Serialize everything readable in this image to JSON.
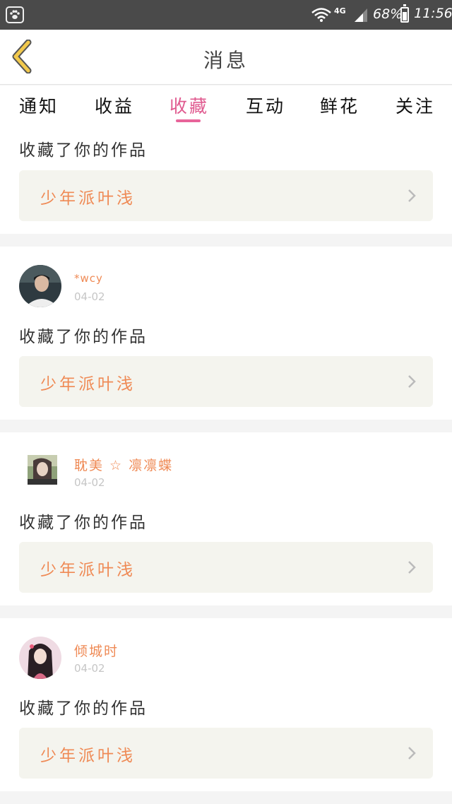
{
  "status_bar": {
    "network": "4G",
    "battery_percent": "68%",
    "battery_level": 0.68,
    "time": "11:56"
  },
  "header": {
    "title": "消息"
  },
  "tabs": [
    {
      "label": "通知",
      "active": false
    },
    {
      "label": "收益",
      "active": false
    },
    {
      "label": "收藏",
      "active": true
    },
    {
      "label": "互动",
      "active": false
    },
    {
      "label": "鲜花",
      "active": false
    },
    {
      "label": "关注",
      "active": false
    }
  ],
  "notifications": [
    {
      "user": "",
      "date": "",
      "action": "收藏了你的作品",
      "work_title": "少年派叶浅"
    },
    {
      "user": "*wcy",
      "date": "04-02",
      "action": "收藏了你的作品",
      "work_title": "少年派叶浅"
    },
    {
      "user": "耽美 ☆ 凛凛蝶",
      "date": "04-02",
      "action": "收藏了你的作品",
      "work_title": "少年派叶浅"
    },
    {
      "user": "倾城时",
      "date": "04-02",
      "action": "收藏了你的作品",
      "work_title": "少年派叶浅"
    }
  ],
  "colors": {
    "accent": "#e05a8f",
    "username": "#ef8a55",
    "status_bar": "#4a4a4a",
    "back_arrow": "#f2c94c"
  },
  "icons": {
    "back": "chevron-left-icon",
    "row": "chevron-right-icon",
    "wifi": "wifi-icon",
    "signal": "signal-icon",
    "battery": "battery-icon"
  }
}
